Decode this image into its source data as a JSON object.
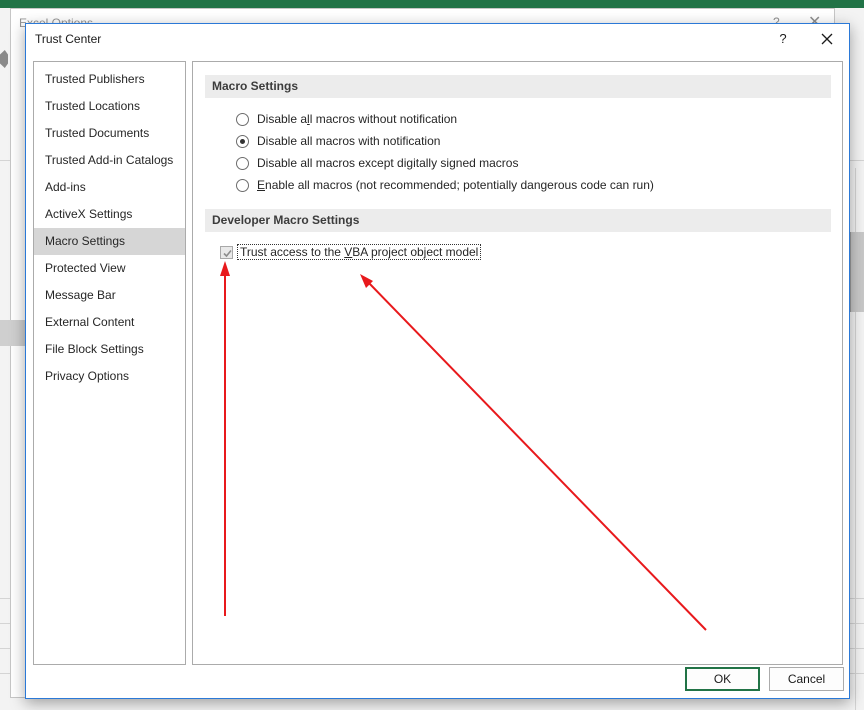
{
  "background": {
    "window_title": "Excel Options",
    "help_glyph": "?",
    "close_glyph": "✕"
  },
  "dialog": {
    "title": "Trust Center",
    "help_label": "?",
    "close_icon": "close-icon"
  },
  "nav": {
    "items": [
      {
        "label": "Trusted Publishers"
      },
      {
        "label": "Trusted Locations"
      },
      {
        "label": "Trusted Documents"
      },
      {
        "label": "Trusted Add-in Catalogs"
      },
      {
        "label": "Add-ins"
      },
      {
        "label": "ActiveX Settings"
      },
      {
        "label": "Macro Settings"
      },
      {
        "label": "Protected View"
      },
      {
        "label": "Message Bar"
      },
      {
        "label": "External Content"
      },
      {
        "label": "File Block Settings"
      },
      {
        "label": "Privacy Options"
      }
    ],
    "selected": "Macro Settings"
  },
  "macro_settings": {
    "header": "Macro Settings",
    "options": [
      {
        "pre": "Disable a",
        "ul": "l",
        "post": "l macros without notification",
        "checked": false
      },
      {
        "pre": "Disable all macros with notification",
        "ul": "",
        "post": "",
        "checked": true
      },
      {
        "pre": "Disable all macros except di",
        "ul": "g",
        "post": "itally signed macros",
        "checked": false
      },
      {
        "pre": "",
        "ul": "E",
        "post": "nable all macros (not recommended; potentially dangerous code can run)",
        "checked": false
      }
    ]
  },
  "developer_settings": {
    "header": "Developer Macro Settings",
    "trust_vba": {
      "pre": "Trust access to the ",
      "ul": "V",
      "post": "BA project object model",
      "checked": true,
      "disabled": true
    }
  },
  "footer": {
    "ok_label": "OK",
    "cancel_label": "Cancel"
  },
  "colors": {
    "excel_green": "#217346",
    "dialog_border": "#2b79d7",
    "selected_nav": "#d6d6d6",
    "section_header": "#ececec",
    "annotation_arrow": "#e8191c"
  }
}
